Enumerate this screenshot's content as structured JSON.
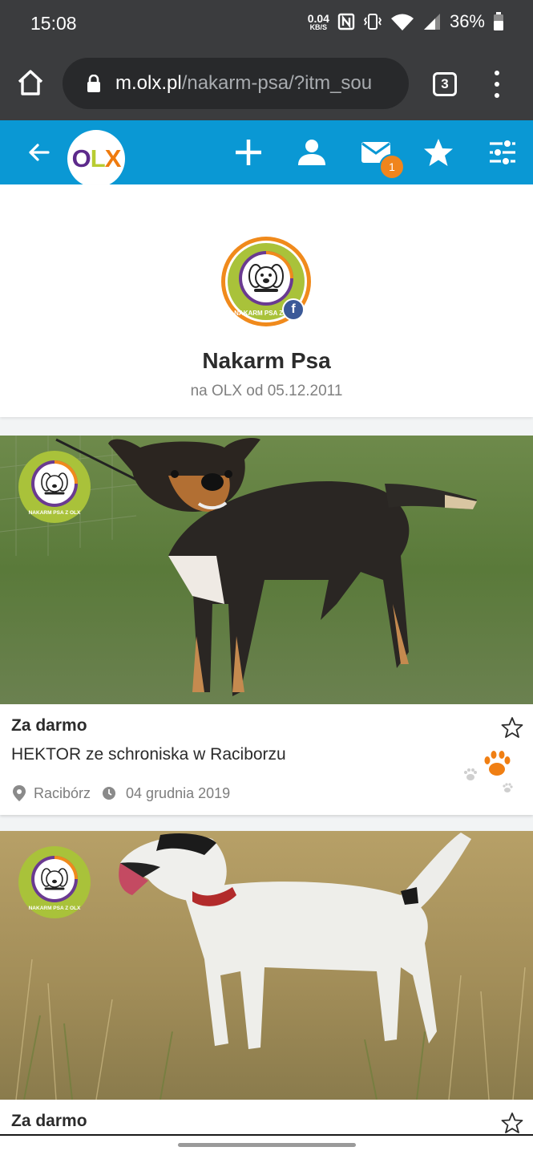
{
  "status_bar": {
    "time": "15:08",
    "net_speed_value": "0.04",
    "net_speed_unit": "KB/S",
    "battery": "36%",
    "icons": [
      "nfc-icon",
      "vibrate-icon",
      "wifi-icon",
      "signal-icon",
      "battery-icon"
    ]
  },
  "browser": {
    "url_domain": "m.olx.pl",
    "url_path": "/nakarm-psa/?itm_sou",
    "tab_count": "3"
  },
  "app_bar": {
    "logo_o": "O",
    "logo_l": "L",
    "logo_x": "X",
    "message_badge": "1",
    "colors": {
      "bar": "#0a98d4",
      "badge": "#f0851d"
    }
  },
  "profile": {
    "name": "Nakarm Psa",
    "since": "na OLX od 05.12.2011",
    "avatar_ring_text": "NAKARM PSA Z OLX",
    "facebook_badge": "f"
  },
  "listings": [
    {
      "price": "Za darmo",
      "title": "HEKTOR ze schroniska w Raciborzu",
      "location": "Racibórz",
      "date": "04 grudnia 2019",
      "watermark_text": "NAKARM PSA Z OLX"
    },
    {
      "price": "Za darmo",
      "watermark_text": "NAKARM PSA Z OLX"
    }
  ]
}
